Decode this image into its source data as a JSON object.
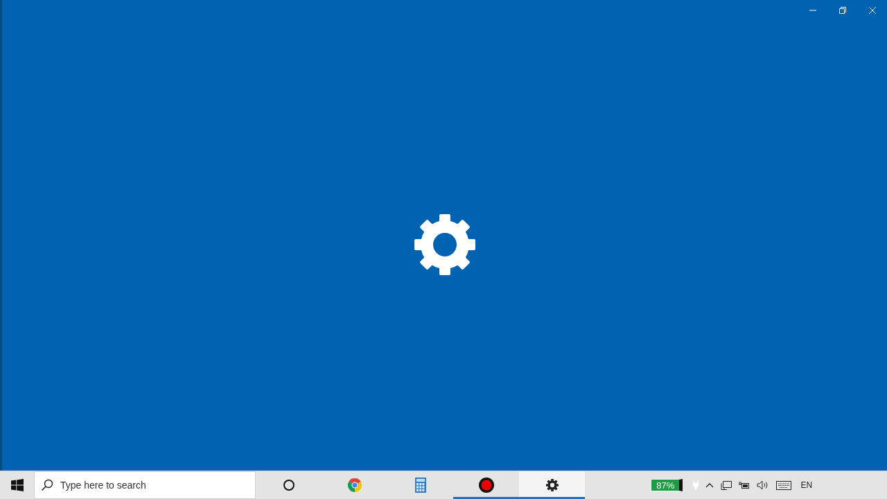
{
  "window": {
    "controls": [
      {
        "kind": "minimize"
      },
      {
        "kind": "restore"
      },
      {
        "kind": "close"
      }
    ]
  },
  "splash": {
    "kind": "gear"
  },
  "taskbar": {
    "search": {
      "placeholder": "Type here to search"
    },
    "apps": [
      {
        "kind": "cortana",
        "running": false,
        "selected": false
      },
      {
        "kind": "chrome",
        "running": false,
        "selected": false
      },
      {
        "kind": "calculator",
        "running": false,
        "selected": false
      },
      {
        "kind": "recorder",
        "running": true,
        "selected": false
      },
      {
        "kind": "settings",
        "running": true,
        "selected": true
      }
    ],
    "battery": {
      "reading": "87%"
    },
    "tray": [
      {
        "kind": "plug"
      },
      {
        "kind": "chevron"
      },
      {
        "kind": "network"
      },
      {
        "kind": "power"
      },
      {
        "kind": "volume"
      },
      {
        "kind": "keyboard"
      }
    ],
    "language": "EN"
  }
}
